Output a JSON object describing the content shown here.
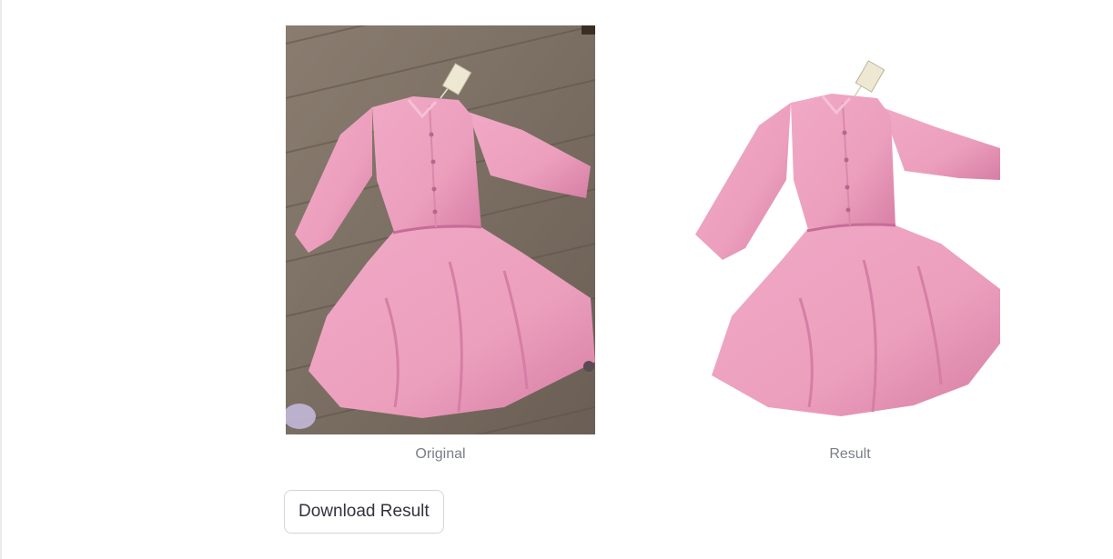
{
  "images": {
    "original": {
      "caption": "Original",
      "background": "#7c7064",
      "dress_color": "#ec9fbd",
      "dress_shadow": "#d67ea5"
    },
    "result": {
      "caption": "Result",
      "background": "#ffffff",
      "dress_color": "#ec9fbd",
      "dress_shadow": "#d67ea5"
    }
  },
  "actions": {
    "download_label": "Download Result"
  }
}
